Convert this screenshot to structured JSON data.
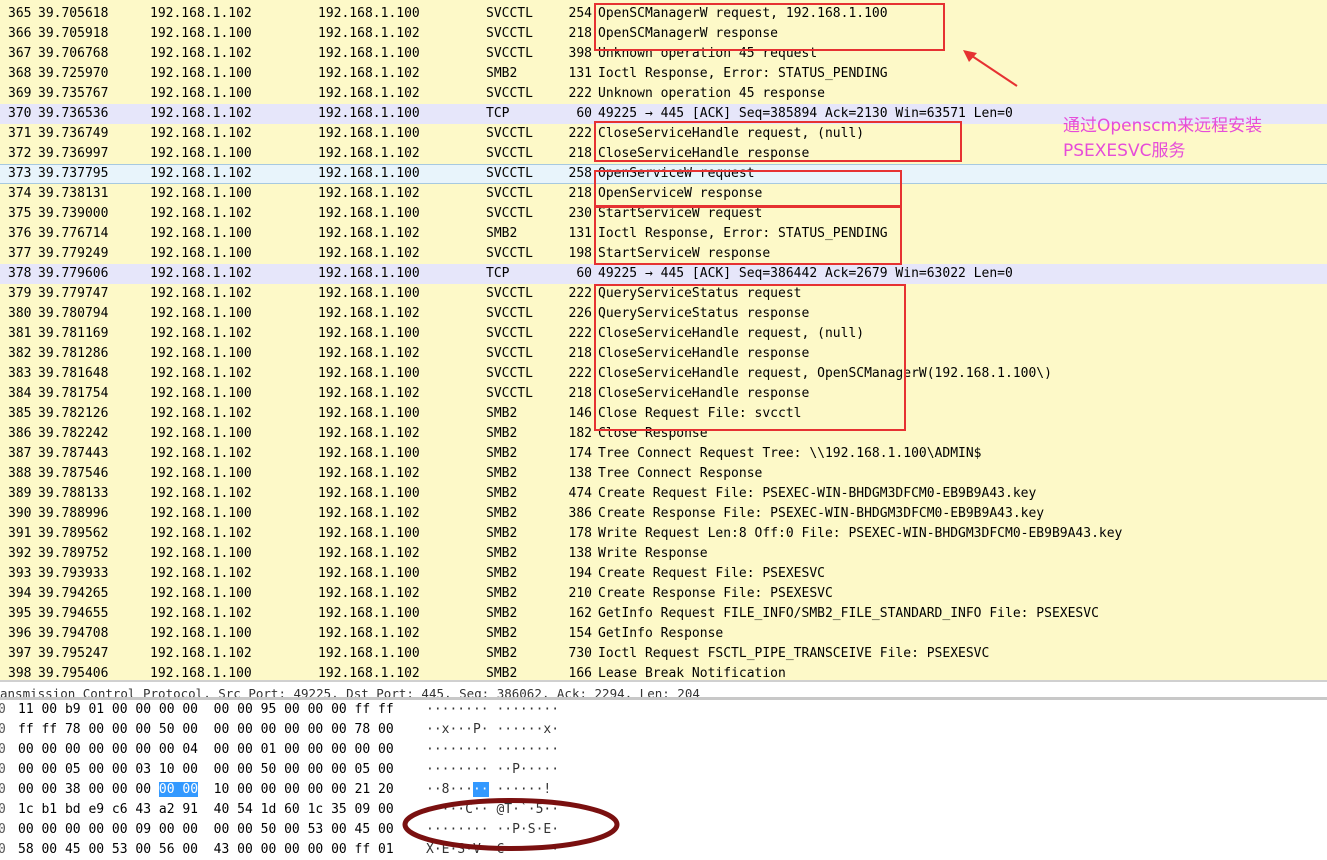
{
  "packets": [
    {
      "no": "365",
      "time": "39.705618",
      "src": "192.168.1.102",
      "dst": "192.168.1.100",
      "proto": "SVCCTL",
      "len": "254",
      "info": "OpenSCManagerW request, 192.168.1.100"
    },
    {
      "no": "366",
      "time": "39.705918",
      "src": "192.168.1.100",
      "dst": "192.168.1.102",
      "proto": "SVCCTL",
      "len": "218",
      "info": "OpenSCManagerW response"
    },
    {
      "no": "367",
      "time": "39.706768",
      "src": "192.168.1.102",
      "dst": "192.168.1.100",
      "proto": "SVCCTL",
      "len": "398",
      "info": "Unknown operation 45 request"
    },
    {
      "no": "368",
      "time": "39.725970",
      "src": "192.168.1.100",
      "dst": "192.168.1.102",
      "proto": "SMB2",
      "len": "131",
      "info": "Ioctl Response, Error: STATUS_PENDING"
    },
    {
      "no": "369",
      "time": "39.735767",
      "src": "192.168.1.100",
      "dst": "192.168.1.102",
      "proto": "SVCCTL",
      "len": "222",
      "info": "Unknown operation 45 response"
    },
    {
      "no": "370",
      "time": "39.736536",
      "src": "192.168.1.102",
      "dst": "192.168.1.100",
      "proto": "TCP",
      "len": "60",
      "info": "49225 → 445 [ACK] Seq=385894 Ack=2130 Win=63571 Len=0"
    },
    {
      "no": "371",
      "time": "39.736749",
      "src": "192.168.1.102",
      "dst": "192.168.1.100",
      "proto": "SVCCTL",
      "len": "222",
      "info": "CloseServiceHandle request, (null)"
    },
    {
      "no": "372",
      "time": "39.736997",
      "src": "192.168.1.100",
      "dst": "192.168.1.102",
      "proto": "SVCCTL",
      "len": "218",
      "info": "CloseServiceHandle response"
    },
    {
      "no": "373",
      "time": "39.737795",
      "src": "192.168.1.102",
      "dst": "192.168.1.100",
      "proto": "SVCCTL",
      "len": "258",
      "info": "OpenServiceW request"
    },
    {
      "no": "374",
      "time": "39.738131",
      "src": "192.168.1.100",
      "dst": "192.168.1.102",
      "proto": "SVCCTL",
      "len": "218",
      "info": "OpenServiceW response"
    },
    {
      "no": "375",
      "time": "39.739000",
      "src": "192.168.1.102",
      "dst": "192.168.1.100",
      "proto": "SVCCTL",
      "len": "230",
      "info": "StartServiceW request"
    },
    {
      "no": "376",
      "time": "39.776714",
      "src": "192.168.1.100",
      "dst": "192.168.1.102",
      "proto": "SMB2",
      "len": "131",
      "info": "Ioctl Response, Error: STATUS_PENDING"
    },
    {
      "no": "377",
      "time": "39.779249",
      "src": "192.168.1.100",
      "dst": "192.168.1.102",
      "proto": "SVCCTL",
      "len": "198",
      "info": "StartServiceW response"
    },
    {
      "no": "378",
      "time": "39.779606",
      "src": "192.168.1.102",
      "dst": "192.168.1.100",
      "proto": "TCP",
      "len": "60",
      "info": "49225 → 445 [ACK] Seq=386442 Ack=2679 Win=63022 Len=0"
    },
    {
      "no": "379",
      "time": "39.779747",
      "src": "192.168.1.102",
      "dst": "192.168.1.100",
      "proto": "SVCCTL",
      "len": "222",
      "info": "QueryServiceStatus request"
    },
    {
      "no": "380",
      "time": "39.780794",
      "src": "192.168.1.100",
      "dst": "192.168.1.102",
      "proto": "SVCCTL",
      "len": "226",
      "info": "QueryServiceStatus response"
    },
    {
      "no": "381",
      "time": "39.781169",
      "src": "192.168.1.102",
      "dst": "192.168.1.100",
      "proto": "SVCCTL",
      "len": "222",
      "info": "CloseServiceHandle request, (null)"
    },
    {
      "no": "382",
      "time": "39.781286",
      "src": "192.168.1.100",
      "dst": "192.168.1.102",
      "proto": "SVCCTL",
      "len": "218",
      "info": "CloseServiceHandle response"
    },
    {
      "no": "383",
      "time": "39.781648",
      "src": "192.168.1.102",
      "dst": "192.168.1.100",
      "proto": "SVCCTL",
      "len": "222",
      "info": "CloseServiceHandle request, OpenSCManagerW(192.168.1.100\\)"
    },
    {
      "no": "384",
      "time": "39.781754",
      "src": "192.168.1.100",
      "dst": "192.168.1.102",
      "proto": "SVCCTL",
      "len": "218",
      "info": "CloseServiceHandle response"
    },
    {
      "no": "385",
      "time": "39.782126",
      "src": "192.168.1.102",
      "dst": "192.168.1.100",
      "proto": "SMB2",
      "len": "146",
      "info": "Close Request File: svcctl"
    },
    {
      "no": "386",
      "time": "39.782242",
      "src": "192.168.1.100",
      "dst": "192.168.1.102",
      "proto": "SMB2",
      "len": "182",
      "info": "Close Response"
    },
    {
      "no": "387",
      "time": "39.787443",
      "src": "192.168.1.102",
      "dst": "192.168.1.100",
      "proto": "SMB2",
      "len": "174",
      "info": "Tree Connect Request Tree: \\\\192.168.1.100\\ADMIN$"
    },
    {
      "no": "388",
      "time": "39.787546",
      "src": "192.168.1.100",
      "dst": "192.168.1.102",
      "proto": "SMB2",
      "len": "138",
      "info": "Tree Connect Response"
    },
    {
      "no": "389",
      "time": "39.788133",
      "src": "192.168.1.102",
      "dst": "192.168.1.100",
      "proto": "SMB2",
      "len": "474",
      "info": "Create Request File: PSEXEC-WIN-BHDGM3DFCM0-EB9B9A43.key"
    },
    {
      "no": "390",
      "time": "39.788996",
      "src": "192.168.1.100",
      "dst": "192.168.1.102",
      "proto": "SMB2",
      "len": "386",
      "info": "Create Response File: PSEXEC-WIN-BHDGM3DFCM0-EB9B9A43.key"
    },
    {
      "no": "391",
      "time": "39.789562",
      "src": "192.168.1.102",
      "dst": "192.168.1.100",
      "proto": "SMB2",
      "len": "178",
      "info": "Write Request Len:8 Off:0 File: PSEXEC-WIN-BHDGM3DFCM0-EB9B9A43.key"
    },
    {
      "no": "392",
      "time": "39.789752",
      "src": "192.168.1.100",
      "dst": "192.168.1.102",
      "proto": "SMB2",
      "len": "138",
      "info": "Write Response"
    },
    {
      "no": "393",
      "time": "39.793933",
      "src": "192.168.1.102",
      "dst": "192.168.1.100",
      "proto": "SMB2",
      "len": "194",
      "info": "Create Request File: PSEXESVC"
    },
    {
      "no": "394",
      "time": "39.794265",
      "src": "192.168.1.100",
      "dst": "192.168.1.102",
      "proto": "SMB2",
      "len": "210",
      "info": "Create Response File: PSEXESVC"
    },
    {
      "no": "395",
      "time": "39.794655",
      "src": "192.168.1.102",
      "dst": "192.168.1.100",
      "proto": "SMB2",
      "len": "162",
      "info": "GetInfo Request FILE_INFO/SMB2_FILE_STANDARD_INFO File: PSEXESVC"
    },
    {
      "no": "396",
      "time": "39.794708",
      "src": "192.168.1.100",
      "dst": "192.168.1.102",
      "proto": "SMB2",
      "len": "154",
      "info": "GetInfo Response"
    },
    {
      "no": "397",
      "time": "39.795247",
      "src": "192.168.1.102",
      "dst": "192.168.1.100",
      "proto": "SMB2",
      "len": "730",
      "info": "Ioctl Request FSCTL_PIPE_TRANSCEIVE File: PSEXESVC"
    },
    {
      "no": "398",
      "time": "39.795406",
      "src": "192.168.1.100",
      "dst": "192.168.1.102",
      "proto": "SMB2",
      "len": "166",
      "info": "Lease Break Notification"
    }
  ],
  "detail_line": "ansmission Control Protocol, Src Port: 49225, Dst Port: 445, Seq: 386062, Ack: 2294, Len: 204",
  "hex_rows": [
    {
      "off": "0",
      "bytes_a": "11 00 b9 01 00 00 00 00  00 00 95 00 00 00 ff ff",
      "hl": "",
      "bytes_b": "",
      "ascii": "········ ········"
    },
    {
      "off": "0",
      "bytes_a": "ff ff 78 00 00 00 50 00  00 00 00 00 00 00 78 00",
      "hl": "",
      "bytes_b": "",
      "ascii": "··x···P· ······x·"
    },
    {
      "off": "0",
      "bytes_a": "00 00 00 00 00 00 00 04  00 00 01 00 00 00 00 00",
      "hl": "",
      "bytes_b": "",
      "ascii": "········ ········"
    },
    {
      "off": "0",
      "bytes_a": "00 00 05 00 00 03 10 00  00 00 50 00 00 00 05 00",
      "hl": "",
      "bytes_b": "",
      "ascii": "········ ··P·····"
    },
    {
      "off": "0",
      "bytes_a": "00 00 38 00 00 00 ",
      "hl": "00 00",
      "bytes_b": "  10 00 00 00 00 00 21 20",
      "ascii": "··8···▪▪ ······!"
    },
    {
      "off": "0",
      "bytes_a": "1c b1 bd e9 c6 43 a2 91  40 54 1d 60 1c 35 09 00",
      "hl": "",
      "bytes_b": "",
      "ascii": "·····C·· @T·`·5··"
    },
    {
      "off": "0",
      "bytes_a": "00 00 00 00 00 09 00 00  00 00 50 00 53 00 45 00",
      "hl": "",
      "bytes_b": "",
      "ascii": "········ ··P·S·E·"
    },
    {
      "off": "0",
      "bytes_a": "58 00 45 00 53 00 56 00  43 00 00 00 00 00 ff 01",
      "hl": "",
      "bytes_b": "",
      "ascii": "X·E·S·V· C·······"
    }
  ],
  "annotation": {
    "line1": "通过Openscm来远程安装",
    "line2": "PSEXESVC服务",
    "color": "#e64cd9"
  },
  "colors": {
    "row_default": "#fdf9c8",
    "row_tcp": "#e6e6fa",
    "row_selected": "#e8f4fb",
    "highlight_box": "#e63232",
    "ellipse": "#7a1010",
    "hex_selection": "#3399ff"
  }
}
